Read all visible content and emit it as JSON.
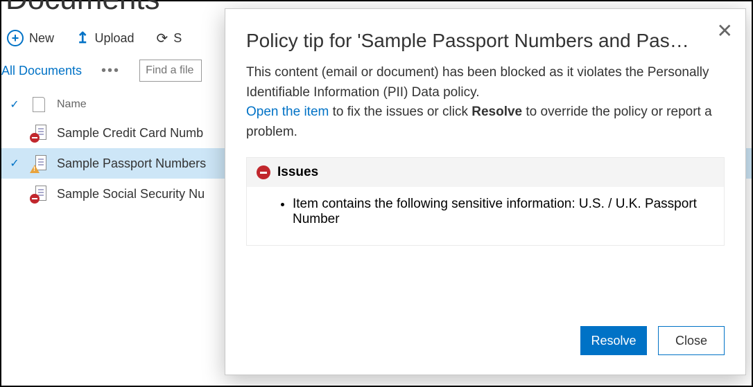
{
  "page": {
    "title": "Documents"
  },
  "toolbar": {
    "new_label": "New",
    "upload_label": "Upload",
    "sync_label": "S"
  },
  "views": {
    "active": "All Documents",
    "search_placeholder": "Find a file"
  },
  "list": {
    "header": {
      "name_col": "Name"
    },
    "rows": [
      {
        "name": "Sample Credit Card Numb",
        "status": "blocked",
        "selected": false
      },
      {
        "name": "Sample Passport Numbers",
        "status": "warning",
        "selected": true
      },
      {
        "name": "Sample Social Security Nu",
        "status": "blocked",
        "selected": false
      }
    ]
  },
  "dialog": {
    "title": "Policy tip for 'Sample Passport Numbers and Passp…",
    "body_line1": "This content (email or document) has been blocked as it violates the Personally Identifiable Information (PII) Data policy.",
    "open_link": "Open the item",
    "body_line2a": " to fix the issues or click ",
    "body_line2_bold": "Resolve",
    "body_line2b": " to override the policy or report a problem.",
    "issues_heading": "Issues",
    "issues": [
      "Item contains the following sensitive information: U.S. / U.K. Passport Number"
    ],
    "resolve_label": "Resolve",
    "close_label": "Close"
  }
}
